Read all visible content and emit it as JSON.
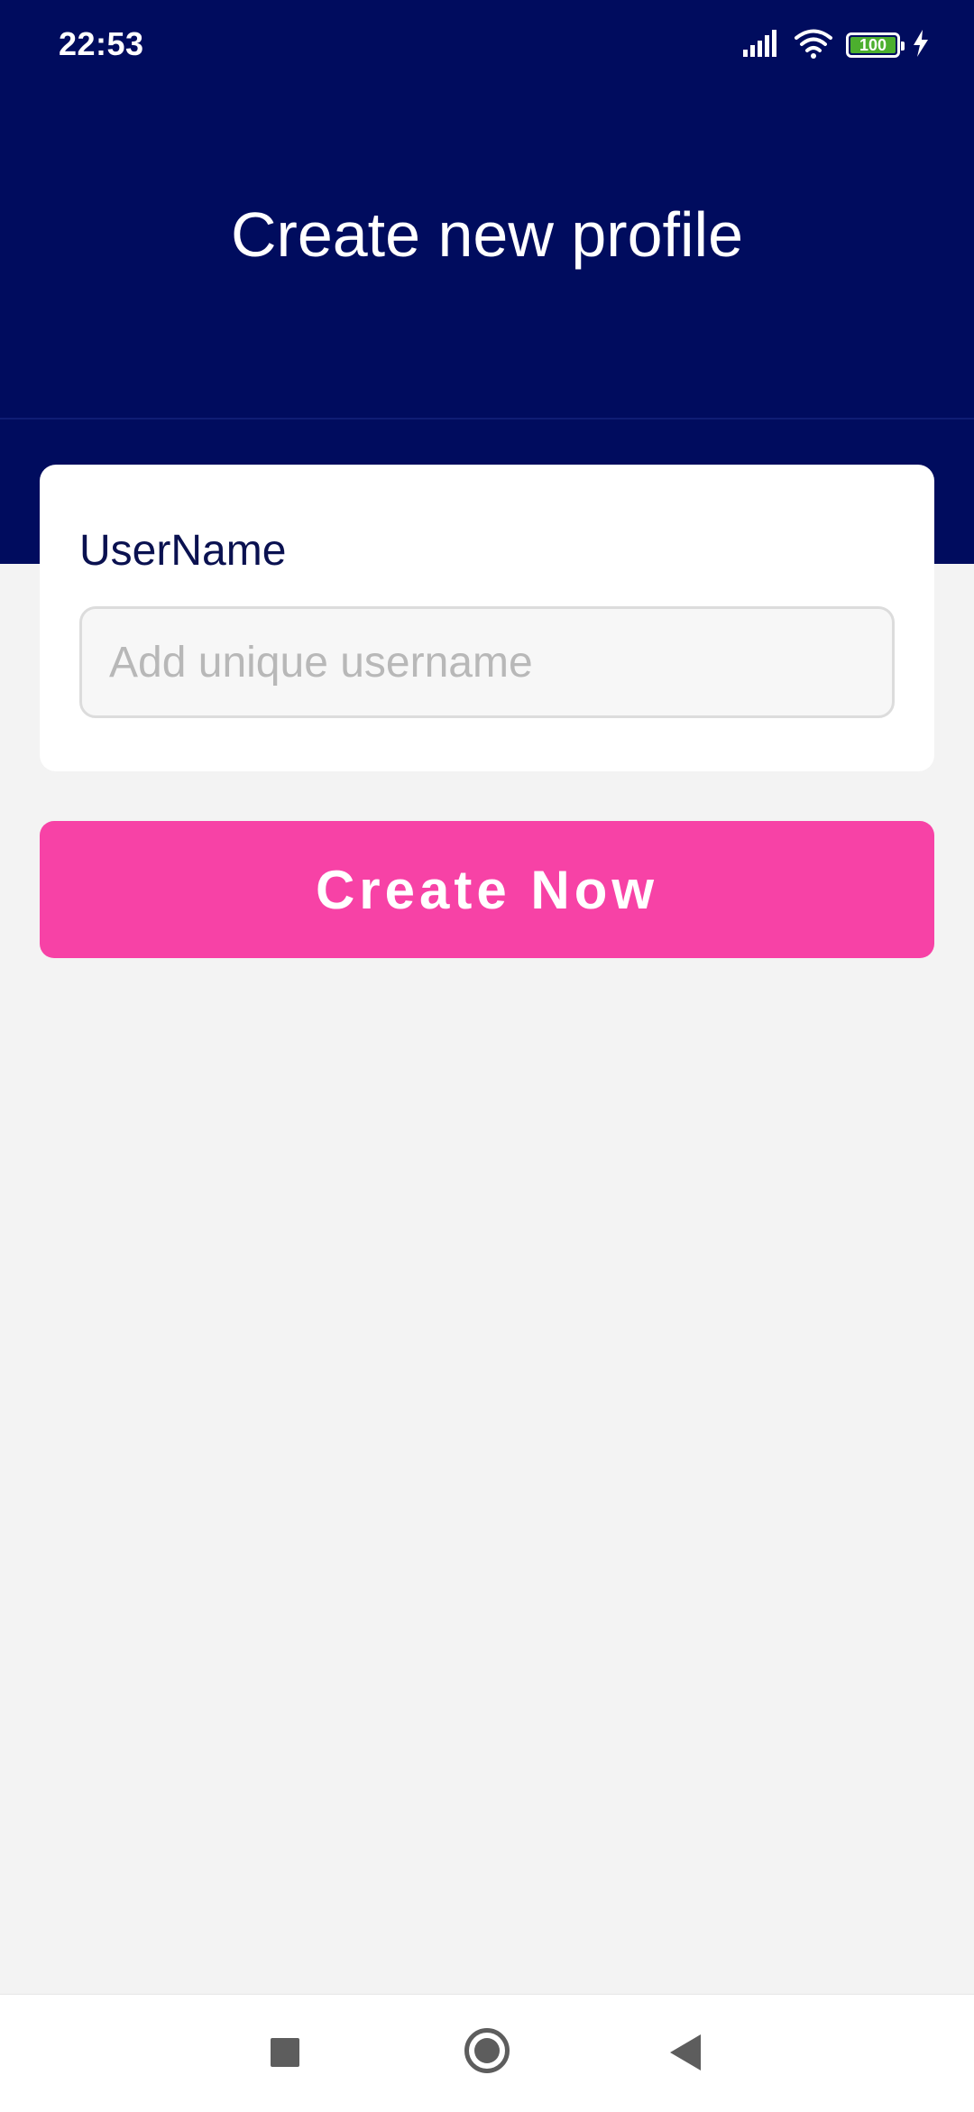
{
  "status_bar": {
    "time": "22:53",
    "battery_level": "100",
    "icons": [
      "signal-icon",
      "wifi-icon",
      "battery-icon",
      "charging-bolt-icon"
    ]
  },
  "header": {
    "title": "Create new profile"
  },
  "form": {
    "username_label": "UserName",
    "username_value": "",
    "username_placeholder": "Add unique username"
  },
  "actions": {
    "create_label": "Create Now"
  },
  "navigation": {
    "items": [
      "recent-apps-icon",
      "home-icon",
      "back-icon"
    ]
  },
  "colors": {
    "header_bg": "#000c5e",
    "accent_button": "#f742a6",
    "page_bg": "#f3f3f3",
    "label_text": "#0a1150"
  }
}
